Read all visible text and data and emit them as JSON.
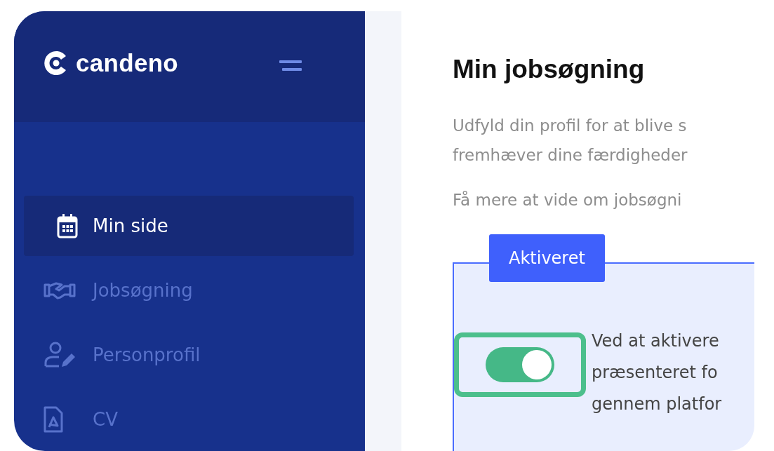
{
  "sidebar": {
    "logo": "candeno",
    "items": [
      {
        "label": "Min side",
        "kind": "calendar",
        "selected": true
      },
      {
        "label": "Jobsøgning",
        "kind": "handshake",
        "selected": false
      },
      {
        "label": "Personprofil",
        "kind": "user-edit",
        "selected": false
      },
      {
        "label": "CV",
        "kind": "pdf",
        "selected": false
      }
    ]
  },
  "main": {
    "title": "Min jobsøgning",
    "intro_lines": [
      "Udfyld din profil for at blive s",
      "fremhæver dine færdigheder"
    ],
    "more_link": "Få mere at vide om jobsøgni",
    "activation": {
      "badge": "Aktiveret",
      "on": true,
      "lines": [
        "Ved at aktivere",
        "præsenteret fo",
        "gennem platfor"
      ]
    }
  }
}
